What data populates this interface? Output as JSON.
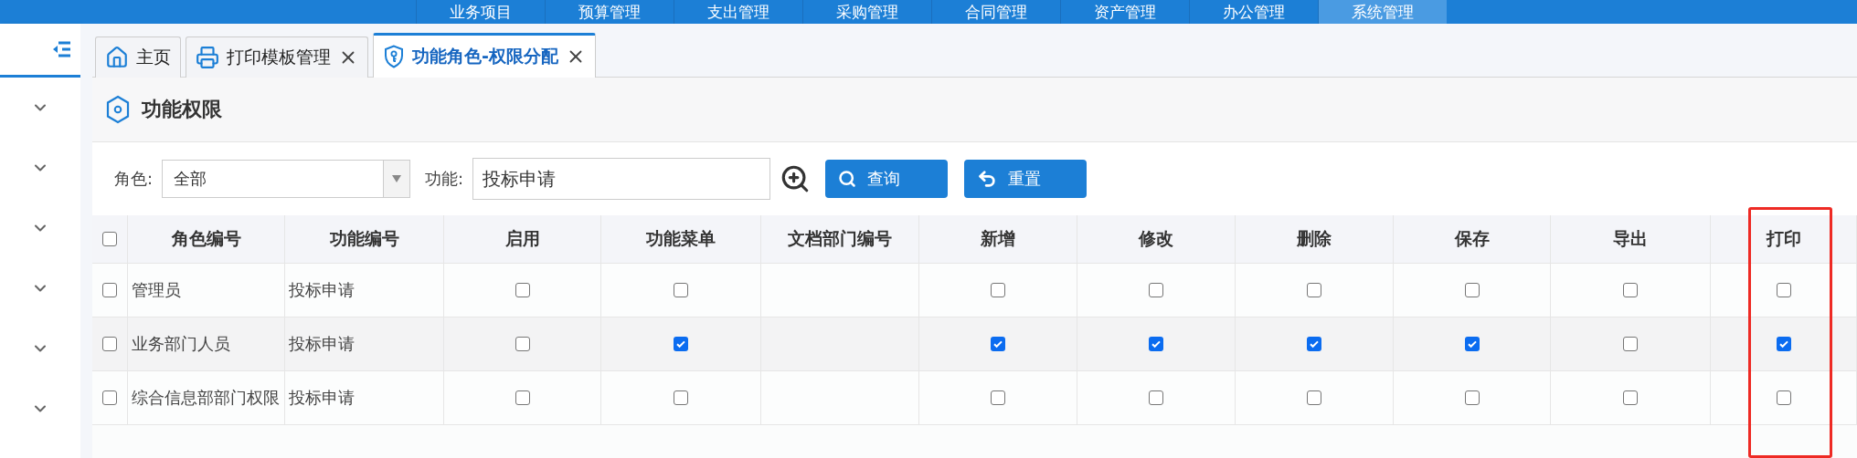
{
  "top_menu": [
    {
      "label": "业务项目",
      "selected": false
    },
    {
      "label": "预算管理",
      "selected": false
    },
    {
      "label": "支出管理",
      "selected": false
    },
    {
      "label": "采购管理",
      "selected": false
    },
    {
      "label": "合同管理",
      "selected": false
    },
    {
      "label": "资产管理",
      "selected": false
    },
    {
      "label": "办公管理",
      "selected": false
    },
    {
      "label": "系统管理",
      "selected": true
    }
  ],
  "sidebar": {
    "items": [
      {
        "expanded": false
      },
      {
        "expanded": false
      },
      {
        "expanded": false
      },
      {
        "expanded": false
      },
      {
        "expanded": false
      },
      {
        "expanded": false
      }
    ]
  },
  "tabs": [
    {
      "label": "主页",
      "kind": "home",
      "closable": false,
      "selected": false
    },
    {
      "label": "打印模板管理",
      "kind": "printer",
      "closable": true,
      "selected": false
    },
    {
      "label": "功能角色-权限分配",
      "kind": "shield",
      "closable": true,
      "selected": true
    }
  ],
  "panel": {
    "title": "功能权限"
  },
  "filters": {
    "role_label": "角色:",
    "role_value": "全部",
    "function_label": "功能:",
    "function_value": "投标申请"
  },
  "buttons": [
    {
      "label": "查询",
      "kind": "search"
    },
    {
      "label": "重置",
      "kind": "reset"
    }
  ],
  "table": {
    "select_all_checked": false,
    "columns": [
      {
        "label": "角色编号",
        "kind": "text"
      },
      {
        "label": "功能编号",
        "kind": "text"
      },
      {
        "label": "启用",
        "kind": "check"
      },
      {
        "label": "功能菜单",
        "kind": "check"
      },
      {
        "label": "文档部门编号",
        "kind": "text"
      },
      {
        "label": "新增",
        "kind": "check"
      },
      {
        "label": "修改",
        "kind": "check"
      },
      {
        "label": "删除",
        "kind": "check"
      },
      {
        "label": "保存",
        "kind": "check"
      },
      {
        "label": "导出",
        "kind": "check"
      },
      {
        "label": "打印",
        "kind": "check",
        "highlighted": true
      }
    ],
    "rows": [
      {
        "selected": false,
        "cells": [
          "管理员",
          "投标申请",
          false,
          false,
          null,
          false,
          false,
          false,
          false,
          false,
          false
        ]
      },
      {
        "selected": false,
        "cells": [
          "业务部门人员",
          "投标申请",
          false,
          true,
          null,
          true,
          true,
          true,
          true,
          false,
          true
        ]
      },
      {
        "selected": false,
        "cells": [
          "综合信息部部门权限",
          "投标申请",
          false,
          false,
          null,
          false,
          false,
          false,
          false,
          false,
          false
        ]
      }
    ]
  }
}
